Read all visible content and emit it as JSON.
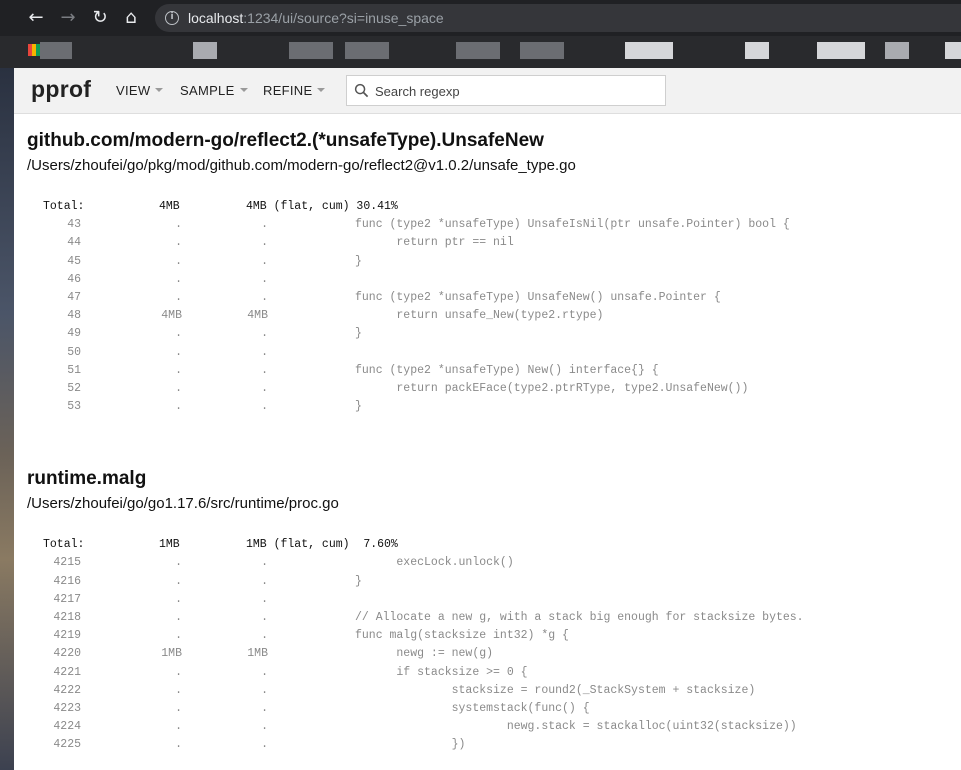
{
  "browser": {
    "url_host": "localhost",
    "url_rest": ":1234/ui/source?si=inuse_space"
  },
  "pprof": {
    "logo": "pprof",
    "menus": [
      "VIEW",
      "SAMPLE",
      "REFINE"
    ],
    "search_placeholder": "Search regexp"
  },
  "sections": [
    {
      "title": "github.com/modern-go/reflect2.(*unsafeType).UnsafeNew",
      "file": "/Users/zhoufei/go/pkg/mod/github.com/modern-go/reflect2@v1.0.2/unsafe_type.go",
      "total": {
        "label": "Total:",
        "flat": "4MB",
        "cum": "4MB (flat, cum) 30.41%"
      },
      "lines": [
        {
          "num": "43",
          "flat": ".",
          "cum": ".",
          "code": "func (type2 *unsafeType) UnsafeIsNil(ptr unsafe.Pointer) bool {"
        },
        {
          "num": "44",
          "flat": ".",
          "cum": ".",
          "code": "      return ptr == nil"
        },
        {
          "num": "45",
          "flat": ".",
          "cum": ".",
          "code": "}"
        },
        {
          "num": "46",
          "flat": ".",
          "cum": ".",
          "code": ""
        },
        {
          "num": "47",
          "flat": ".",
          "cum": ".",
          "code": "func (type2 *unsafeType) UnsafeNew() unsafe.Pointer {"
        },
        {
          "num": "48",
          "flat": "4MB",
          "cum": "4MB",
          "code": "      return unsafe_New(type2.rtype)"
        },
        {
          "num": "49",
          "flat": ".",
          "cum": ".",
          "code": "}"
        },
        {
          "num": "50",
          "flat": ".",
          "cum": ".",
          "code": ""
        },
        {
          "num": "51",
          "flat": ".",
          "cum": ".",
          "code": "func (type2 *unsafeType) New() interface{} {"
        },
        {
          "num": "52",
          "flat": ".",
          "cum": ".",
          "code": "      return packEFace(type2.ptrRType, type2.UnsafeNew())"
        },
        {
          "num": "53",
          "flat": ".",
          "cum": ".",
          "code": "}"
        }
      ]
    },
    {
      "title": "runtime.malg",
      "file": "/Users/zhoufei/go/go1.17.6/src/runtime/proc.go",
      "total": {
        "label": "Total:",
        "flat": "1MB",
        "cum": "1MB (flat, cum)  7.60%"
      },
      "lines": [
        {
          "num": "4215",
          "flat": ".",
          "cum": ".",
          "code": "      execLock.unlock()"
        },
        {
          "num": "4216",
          "flat": ".",
          "cum": ".",
          "code": "}"
        },
        {
          "num": "4217",
          "flat": ".",
          "cum": ".",
          "code": ""
        },
        {
          "num": "4218",
          "flat": ".",
          "cum": ".",
          "code": "// Allocate a new g, with a stack big enough for stacksize bytes."
        },
        {
          "num": "4219",
          "flat": ".",
          "cum": ".",
          "code": "func malg(stacksize int32) *g {"
        },
        {
          "num": "4220",
          "flat": "1MB",
          "cum": "1MB",
          "code": "      newg := new(g)"
        },
        {
          "num": "4221",
          "flat": ".",
          "cum": ".",
          "code": "      if stacksize >= 0 {"
        },
        {
          "num": "4222",
          "flat": ".",
          "cum": ".",
          "code": "              stacksize = round2(_StackSystem + stacksize)"
        },
        {
          "num": "4223",
          "flat": ".",
          "cum": ".",
          "code": "              systemstack(func() {"
        },
        {
          "num": "4224",
          "flat": ".",
          "cum": ".",
          "code": "                      newg.stack = stackalloc(uint32(stacksize))"
        },
        {
          "num": "4225",
          "flat": ".",
          "cum": ".",
          "code": "              })"
        }
      ]
    }
  ]
}
